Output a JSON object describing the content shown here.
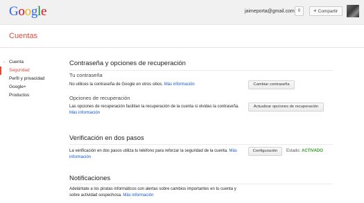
{
  "header": {
    "logo_letters": [
      {
        "ch": "G",
        "color": "#3369e8"
      },
      {
        "ch": "o",
        "color": "#d50f25"
      },
      {
        "ch": "o",
        "color": "#eeb211"
      },
      {
        "ch": "g",
        "color": "#3369e8"
      },
      {
        "ch": "l",
        "color": "#009925"
      },
      {
        "ch": "e",
        "color": "#d50f25"
      }
    ],
    "email": "jaimeporta@gmail.com",
    "notification_count": "0",
    "share_plus": "+",
    "share_label": "Compartir"
  },
  "section_title": "Cuentas",
  "sidebar": {
    "items": [
      {
        "label": "Cuenta",
        "arrow": "›"
      },
      {
        "label": "Seguridad"
      },
      {
        "label": "Perfil y privacidad"
      },
      {
        "label": "Google+"
      },
      {
        "label": "Productos"
      }
    ],
    "active_index": 1
  },
  "password_section": {
    "title": "Contraseña y opciones de recuperación",
    "password": {
      "heading": "Tu contraseña",
      "text": "No utilices la contraseña de Google en otros sitios.",
      "link": "Más información",
      "button": "Cambiar contraseña"
    },
    "recovery": {
      "heading": "Opciones de recuperación",
      "text": "Las opciones de recuperación facilitan la recuperación de la cuenta si olvidas la contraseña.",
      "link": "Más información",
      "button": "Actualizar opciones de recuperación"
    }
  },
  "two_step_section": {
    "title": "Verificación en dos pasos",
    "text": "La verificación en dos pasos utiliza tu teléfono para reforzar la seguridad de la cuenta.",
    "link": "Más información",
    "button": "Configuración",
    "status_label": "Estado:",
    "status_value": "ACTIVADO",
    "status_color": "#3b9a2b"
  },
  "notifications_section": {
    "title": "Notificaciones",
    "text": "Adelántate a los piratas informáticos con alertas sobre cambios importantes en tu cuenta y sobre actividad sospechosa.",
    "link": "Más información"
  },
  "colors": {
    "accent": "#dd4b39",
    "link": "#1155cc"
  }
}
